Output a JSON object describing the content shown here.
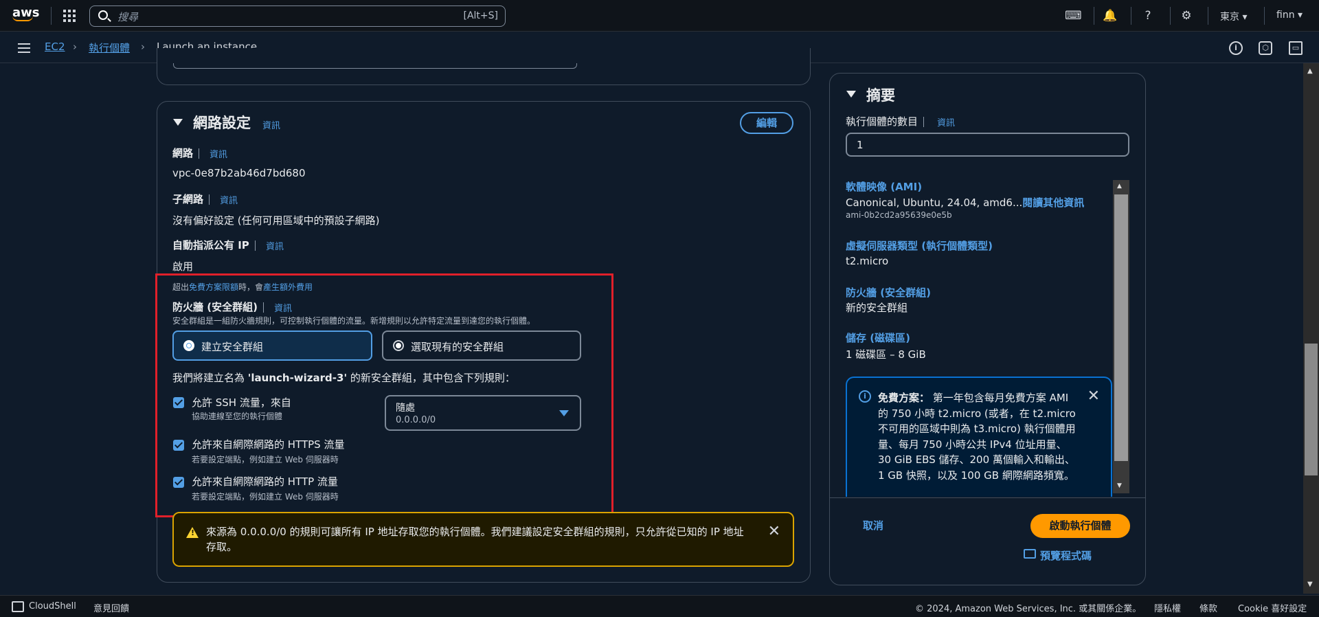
{
  "topnav": {
    "logo": "aws",
    "search_placeholder": "搜尋",
    "search_shortcut": "[Alt+S]",
    "region": "東京 ▾",
    "user": "finn ▾",
    "icons": [
      "cloudshell-icon",
      "bell-icon",
      "help-icon",
      "gear-icon"
    ]
  },
  "breadcrumb": {
    "items": [
      "EC2",
      "執行個體",
      "Launch an instance"
    ]
  },
  "network": {
    "title": "網路設定",
    "info": "資訊",
    "edit_button": "編輯",
    "network_label": "網路",
    "network_value": "vpc-0e87b2ab46d7bd680",
    "subnet_label": "子網路",
    "subnet_value": "沒有偏好設定 (任何可用區域中的預設子網路)",
    "public_ip_label": "自動指派公有 IP",
    "public_ip_value": "啟用",
    "free_tier_prefix": "超出",
    "free_tier_link": "免費方案限額",
    "free_tier_mid": "時，會",
    "free_tier_link2": "產生額外費用",
    "firewall_label": "防火牆 (安全群組)",
    "firewall_desc": "安全群組是一組防火牆規則，可控制執行個體的流量。新增規則以允許特定流量到達您的執行個體。",
    "radio_create": "建立安全群組",
    "radio_select": "選取現有的安全群組",
    "rules_intro_prefix": "我們將建立名為 ",
    "rules_intro_name": "'launch-wizard-3'",
    "rules_intro_suffix": " 的新安全群組，其中包含下列規則：",
    "rule_ssh": "允許 SSH 流量，來自",
    "rule_ssh_desc": "協助連線至您的執行個體",
    "select_title": "隨處",
    "select_value": "0.0.0.0/0",
    "rule_https": "允許來自網際網路的 HTTPS 流量",
    "rule_https_desc": "若要設定端點，例如建立 Web 伺服器時",
    "rule_http": "允許來自網際網路的 HTTP 流量",
    "rule_http_desc": "若要設定端點，例如建立 Web 伺服器時",
    "warning": "來源為 0.0.0.0/0 的規則可讓所有 IP 地址存取您的執行個體。我們建議設定安全群組的規則，只允許從已知的 IP 地址存取。"
  },
  "summary": {
    "title": "摘要",
    "count_label": "執行個體的數目",
    "info": "資訊",
    "count_value": "1",
    "ami_label": "軟體映像 (AMI)",
    "ami_value": "Canonical, Ubuntu, 24.04, amd6...",
    "ami_link": "閱讀其他資訊",
    "ami_id": "ami-0b2cd2a95639e0e5b",
    "type_label": "虛擬伺服器類型 (執行個體類型)",
    "type_value": "t2.micro",
    "fw_label": "防火牆 (安全群組)",
    "fw_value": "新的安全群組",
    "storage_label": "儲存 (磁碟區)",
    "storage_value": "1 磁碟區 – 8 GiB",
    "free_tier_title": "免費方案：",
    "free_tier_text": "第一年包含每月免費方案 AMI 的 750 小時 t2.micro (或者，在 t2.micro 不可用的區域中則為 t3.micro) 執行個體用量、每月 750 小時公共 IPv4 位址用量、30 GiB EBS 儲存、200 萬個輸入和輸出、1 GB 快照，以及 100 GB 網際網路頻寬。",
    "cancel": "取消",
    "launch": "啟動執行個體",
    "preview": "預覽程式碼"
  },
  "statusbar": {
    "cloudshell": "CloudShell",
    "feedback": "意見回饋",
    "copyright": "© 2024, Amazon Web Services, Inc. 或其關係企業。",
    "privacy": "隱私權",
    "terms": "條款",
    "cookie": "Cookie 喜好設定"
  }
}
